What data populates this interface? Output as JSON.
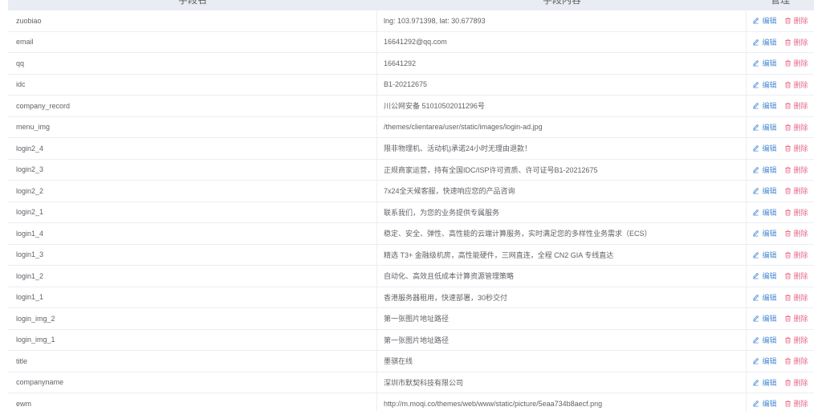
{
  "header": {
    "col_name": "字段名",
    "col_value": "字段内容",
    "col_ops": "管理"
  },
  "actions": {
    "edit_label": "编辑",
    "delete_label": "删除",
    "edit_icon": "pencil-icon",
    "delete_icon": "trash-icon",
    "edit_color": "#4a8bd6",
    "delete_color": "#e86a8a"
  },
  "rows": [
    {
      "name": "zuobiao",
      "value": "lng: 103.971398, lat: 30.677893"
    },
    {
      "name": "email",
      "value": "16641292@qq.com"
    },
    {
      "name": "qq",
      "value": "16641292"
    },
    {
      "name": "idc",
      "value": "B1-20212675"
    },
    {
      "name": "company_record",
      "value": "川公网安备 51010502011296号"
    },
    {
      "name": "menu_img",
      "value": "/themes/clientarea/user/static/images/login-ad.jpg"
    },
    {
      "name": "login2_4",
      "value": "限非物理机、活动机)承诺24小时无理由退款！"
    },
    {
      "name": "login2_3",
      "value": "正规商家运营，持有全国IDC/ISP许可资质、许可证号B1-20212675"
    },
    {
      "name": "login2_2",
      "value": "7x24全天候客服，快速响应您的产品咨询"
    },
    {
      "name": "login2_1",
      "value": "联系我们，为您的业务提供专属服务"
    },
    {
      "name": "login1_4",
      "value": "稳定、安全、弹性、高性能的云端计算服务，实时满足您的多样性业务需求（ECS）"
    },
    {
      "name": "login1_3",
      "value": "精选 T3+ 金融级机房，高性能硬件，三网直连，全程 CN2 GIA 专线直达"
    },
    {
      "name": "login1_2",
      "value": "自动化、高效且低成本计算资源管理策略"
    },
    {
      "name": "login1_1",
      "value": "香港服务器租用，快速部署，30秒交付"
    },
    {
      "name": "login_img_2",
      "value": "第一张图片地址路径"
    },
    {
      "name": "login_img_1",
      "value": "第一张图片地址路径"
    },
    {
      "name": "title",
      "value": "墨骐在线"
    },
    {
      "name": "companyname",
      "value": "深圳市默契科技有限公司"
    },
    {
      "name": "ewm",
      "value": "http://m.moqi.co/themes/web/www/static/picture/5eaa734b8aecf.png"
    }
  ]
}
